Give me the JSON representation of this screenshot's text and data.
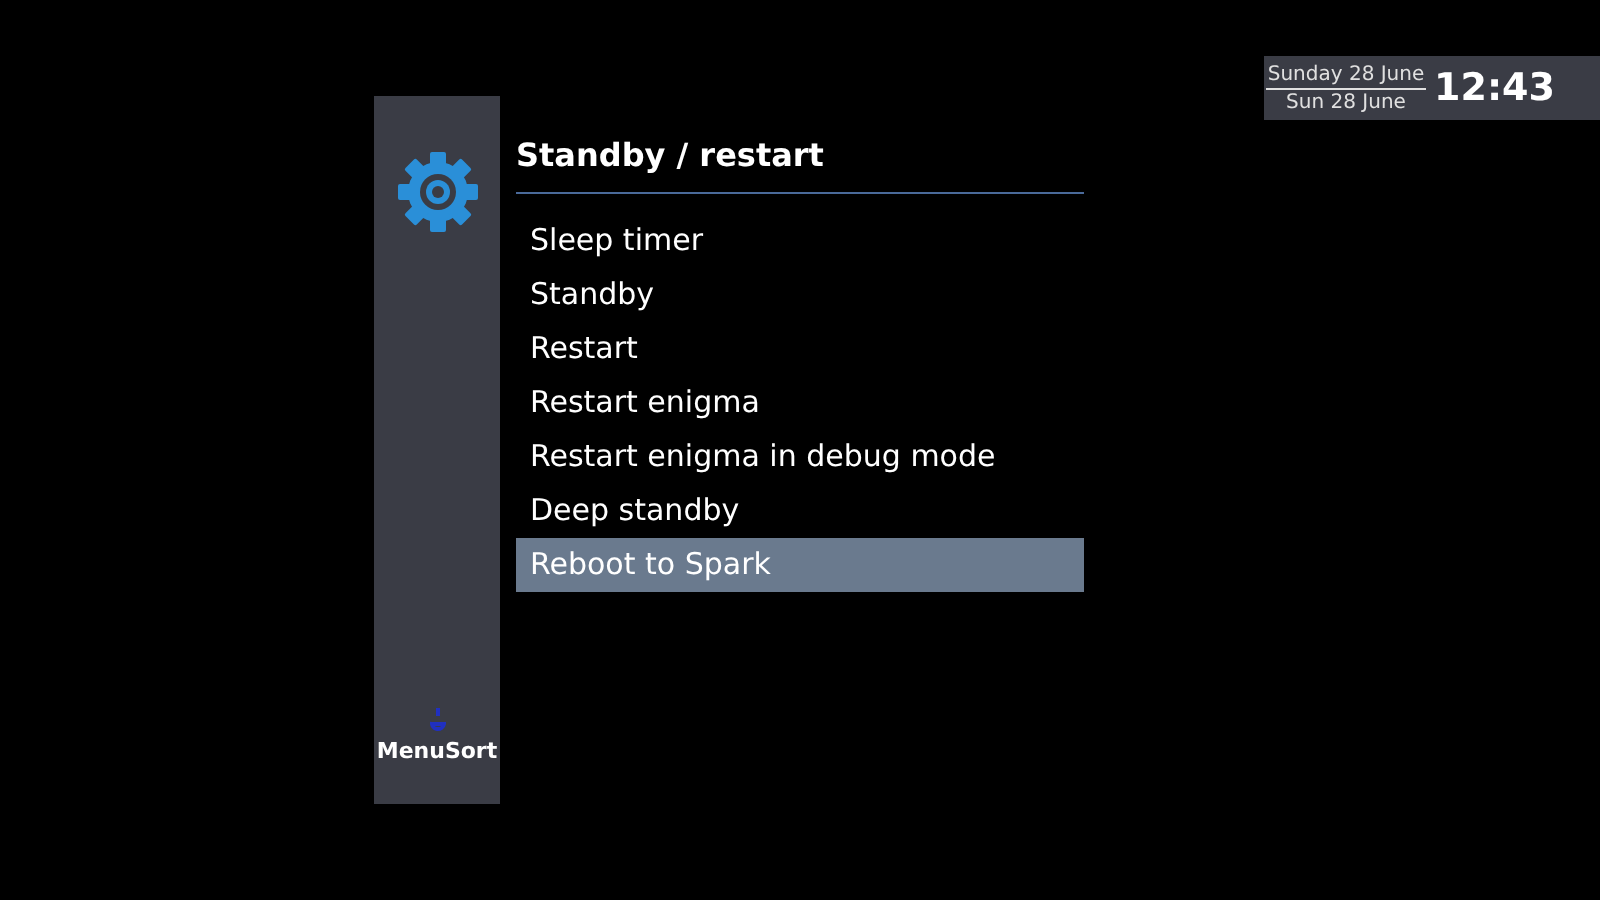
{
  "clock": {
    "date_long": "Sunday 28 June",
    "date_short": "Sun 28 June",
    "time": "12:43"
  },
  "sidebar": {
    "button_label": "MenuSort"
  },
  "menu": {
    "title": "Standby / restart",
    "items": [
      {
        "label": "Sleep timer",
        "selected": false
      },
      {
        "label": "Standby",
        "selected": false
      },
      {
        "label": "Restart",
        "selected": false
      },
      {
        "label": "Restart enigma",
        "selected": false
      },
      {
        "label": "Restart enigma in debug mode",
        "selected": false
      },
      {
        "label": "Deep standby",
        "selected": false
      },
      {
        "label": "Reboot to Spark",
        "selected": true
      }
    ]
  }
}
